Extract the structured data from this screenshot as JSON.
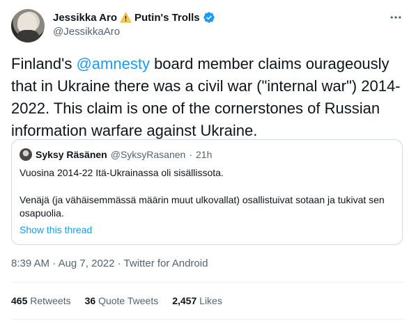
{
  "author": {
    "display_name": "Jessikka Aro",
    "name_suffix": "Putin's Trolls",
    "handle": "@JessikkaAro"
  },
  "tweet": {
    "text_before": "Finland's ",
    "mention": "@amnesty",
    "text_after": " board member claims ourageously that in Ukraine there was a civil war (\"internal war\") 2014-2022. This claim is one of the cornerstones of Russian information warfare against Ukraine."
  },
  "quote": {
    "name": "Syksy Räsänen",
    "handle": "@SyksyRasanen",
    "separator": "·",
    "age": "21h",
    "line1": "Vuosina 2014-22 Itä-Ukrainassa oli sisällissota.",
    "line2": "Venäjä (ja vähäisemmässä määrin muut ulkovallat) osallistuivat sotaan ja tukivat sen osapuolia.",
    "show_thread": "Show this thread"
  },
  "meta": {
    "time": "8:39 AM",
    "sep1": " · ",
    "date": "Aug 7, 2022",
    "sep2": " · ",
    "source": "Twitter for Android"
  },
  "stats": {
    "retweets_count": "465",
    "retweets_label": "Retweets",
    "quotes_count": "36",
    "quotes_label": "Quote Tweets",
    "likes_count": "2,457",
    "likes_label": "Likes"
  },
  "colors": {
    "accent": "#1d9bf0",
    "text": "#0f1419",
    "secondary": "#536471",
    "border": "#cfd9de",
    "warning": "#ffcc4d"
  },
  "icons": {
    "warning": "warning-icon",
    "verified": "verified-badge-icon",
    "more": "more-options-icon"
  }
}
